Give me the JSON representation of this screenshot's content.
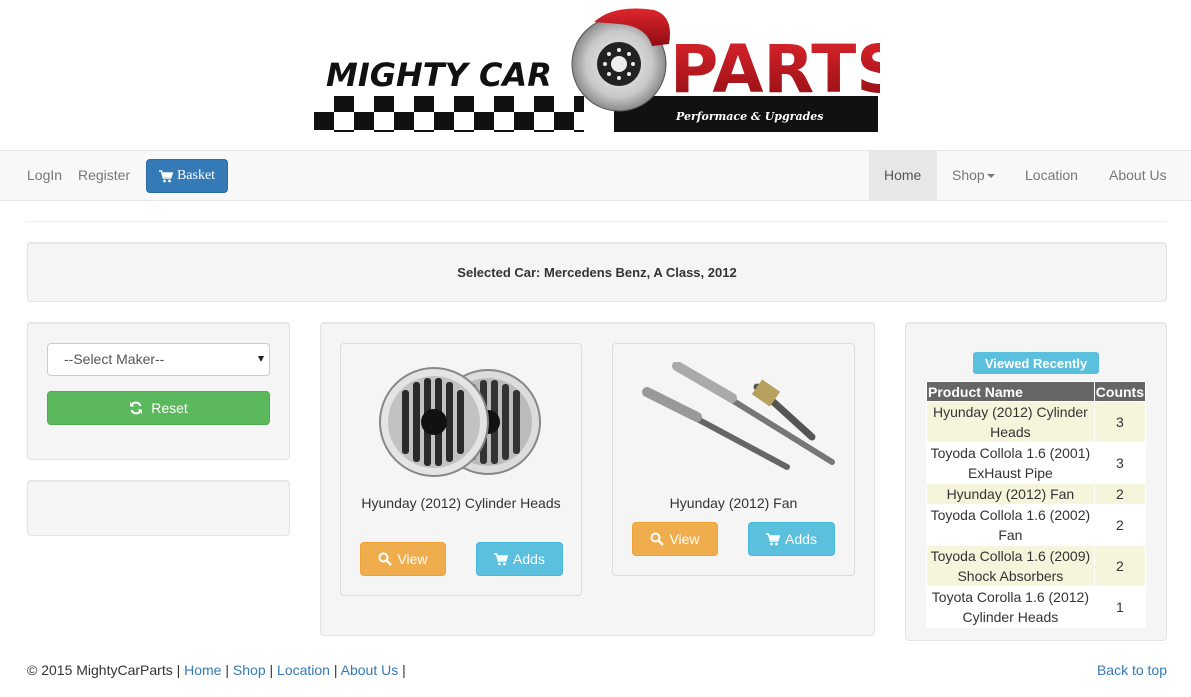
{
  "brand": {
    "logo_word1": "MIGHTY CAR",
    "logo_word2": "PARTS",
    "tagline": "Performace & Upgrades",
    "colors": {
      "red": "#c0141c",
      "black": "#111111"
    }
  },
  "navbar": {
    "login": "LogIn",
    "register": "Register",
    "basket": "Basket",
    "home": "Home",
    "shop": "Shop",
    "location": "Location",
    "about": "About Us"
  },
  "selected_car": "Selected Car: Mercedens Benz, A Class, 2012",
  "filter": {
    "select_value": "--Select Maker--",
    "reset": "Reset"
  },
  "products": [
    {
      "name": "Hyunday (2012) Cylinder Heads",
      "view": "View",
      "adds": "Adds",
      "image": "horn-speakers"
    },
    {
      "name": "Hyunday (2012) Fan",
      "view": "View",
      "adds": "Adds",
      "image": "glow-plugs"
    }
  ],
  "recent": {
    "label": "Viewed Recently",
    "headers": [
      "Product Name",
      "Counts"
    ],
    "rows": [
      {
        "name": "Hyunday (2012) Cylinder Heads",
        "count": "3"
      },
      {
        "name": "Toyoda Collola 1.6 (2001) ExHaust Pipe",
        "count": "3"
      },
      {
        "name": "Hyunday (2012) Fan",
        "count": "2"
      },
      {
        "name": "Toyoda Collola 1.6 (2002) Fan",
        "count": "2"
      },
      {
        "name": "Toyoda Collola 1.6 (2009) Shock Absorbers",
        "count": "2"
      },
      {
        "name": "Toyota Corolla 1.6 (2012) Cylinder Heads",
        "count": "1"
      }
    ]
  },
  "footer": {
    "copyright": "© 2015 MightyCarParts |",
    "home": "Home",
    "shop": "Shop",
    "location": "Location",
    "about": "About Us",
    "sep": "|",
    "back_to_top": "Back to top"
  }
}
